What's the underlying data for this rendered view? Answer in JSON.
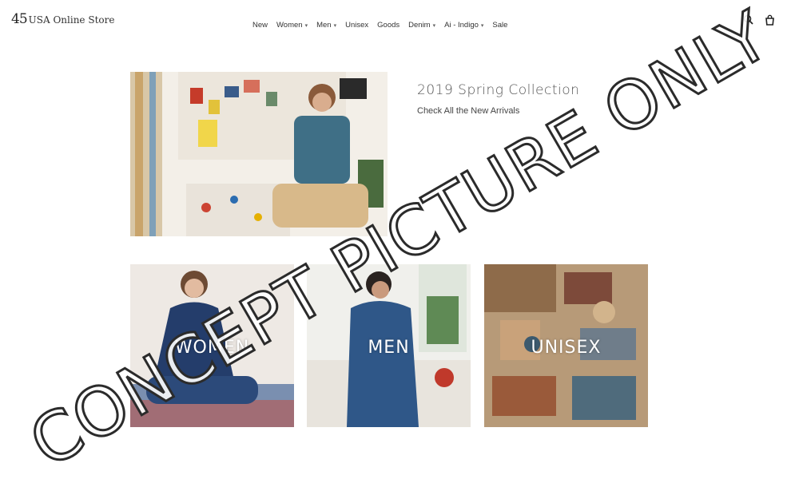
{
  "header": {
    "logo_mark": "45",
    "logo_text": "USA Online Store",
    "nav": [
      {
        "label": "New",
        "dropdown": false
      },
      {
        "label": "Women",
        "dropdown": true
      },
      {
        "label": "Men",
        "dropdown": true
      },
      {
        "label": "Unisex",
        "dropdown": false
      },
      {
        "label": "Goods",
        "dropdown": false
      },
      {
        "label": "Denim",
        "dropdown": true
      },
      {
        "label": "Ai - Indigo",
        "dropdown": true
      },
      {
        "label": "Sale",
        "dropdown": false
      }
    ],
    "icons": [
      "search-icon",
      "bag-icon"
    ]
  },
  "hero": {
    "title": "2019 Spring Collection",
    "subtitle": "Check All the New Arrivals"
  },
  "categories": {
    "women": "WOMEN",
    "men": "MEN",
    "unisex": "UNISEX"
  },
  "watermark": "CONCEPT PICTURE ONLY",
  "colors": {
    "background": "#ffffff",
    "text": "#444444",
    "denim": "#2e4f7a"
  }
}
